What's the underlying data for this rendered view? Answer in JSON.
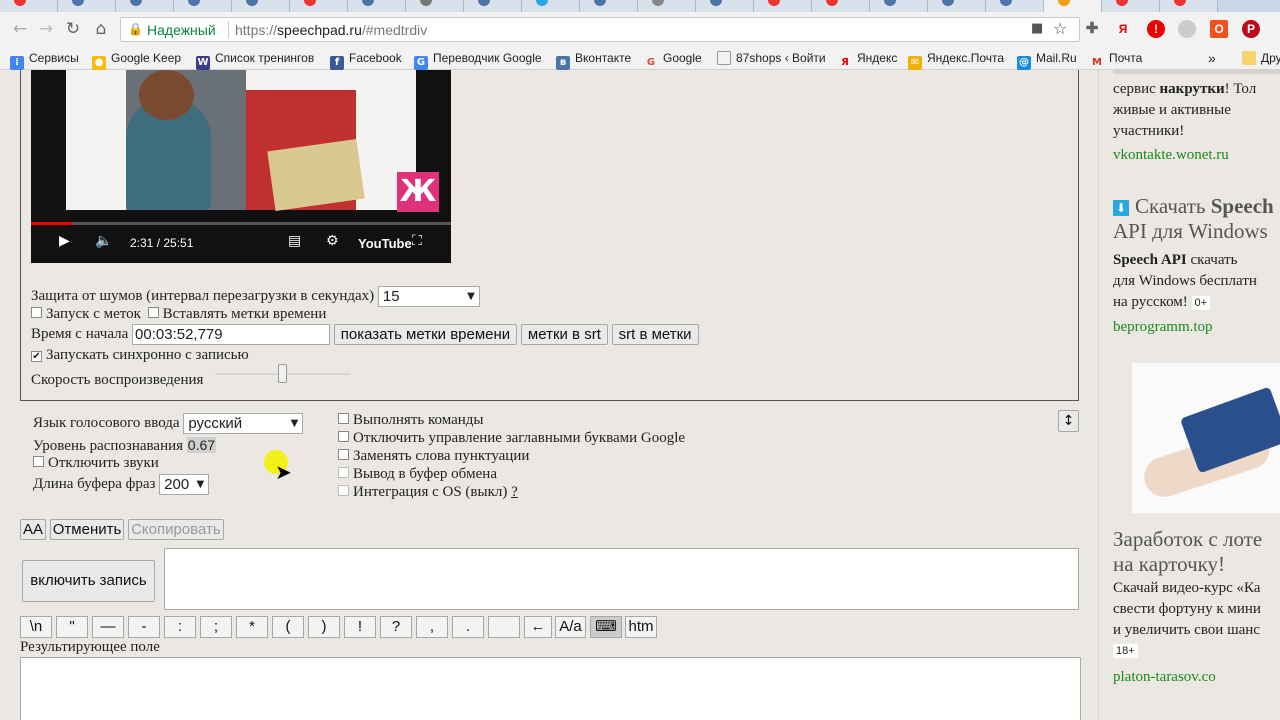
{
  "browser": {
    "security_label": "Надежный",
    "url_prefix": "https://",
    "url_host": "speechpad.ru",
    "url_path": "/#medtrdiv",
    "bookmarks": [
      {
        "label": "Сервисы",
        "icon": "apps-grid-icon",
        "color": "#4285f4"
      },
      {
        "label": "Google Keep",
        "icon": "keep-icon",
        "color": "#fbbc04"
      },
      {
        "label": "Список тренингов",
        "icon": "w-icon",
        "color": "#3a3a8a"
      },
      {
        "label": "Facebook",
        "icon": "facebook-icon",
        "color": "#3b5998"
      },
      {
        "label": "Переводчик Google",
        "icon": "translate-icon",
        "color": "#4285f4"
      },
      {
        "label": "Вконтакте",
        "icon": "vk-icon",
        "color": "#4a76a8"
      },
      {
        "label": "Google",
        "icon": "google-icon",
        "color": "#ea4335"
      },
      {
        "label": "87shops ‹ Войти",
        "icon": "page-icon",
        "color": "#777777"
      },
      {
        "label": "Яндекс",
        "icon": "yandex-icon",
        "color": "#e00000"
      },
      {
        "label": "Яндекс.Почта",
        "icon": "mail-envelope-icon",
        "color": "#f2b100"
      },
      {
        "label": "Mail.Ru",
        "icon": "at-icon",
        "color": "#168de2"
      },
      {
        "label": "Почта",
        "icon": "gmail-icon",
        "color": "#d93025"
      }
    ],
    "bookmarks_overflow": "»",
    "bookmarks_folder": "Дру"
  },
  "video": {
    "time": "2:31 / 25:51",
    "brand": "YouTube",
    "channel_logo": "Ж",
    "progress": 0.098
  },
  "settings": {
    "noise_label": "Защита от шумов (интервал перезагрузки в секундах)",
    "noise_value": "15",
    "start_from_marks": "Запуск с меток",
    "insert_time_marks": "Вставлять метки времени",
    "time_from_start_label": "Время с начала",
    "time_from_start_value": "00:03:52,779",
    "show_marks_button": "показать метки времени",
    "marks_to_srt_button": "метки в srt",
    "srt_to_marks_button": "srt в метки",
    "sync_label": "Запускать синхронно с записью",
    "sync_checked": true,
    "speed_label": "Скорость воспроизведения"
  },
  "voice": {
    "language_label": "Язык голосового ввода",
    "language_value": "русский",
    "recognition_label": "Уровень распознавания",
    "recognition_value": "0.67",
    "disable_sounds": "Отключить звуки",
    "buffer_label": "Длина буфера фраз",
    "buffer_value": "200",
    "options": [
      "Выполнять команды",
      "Отключить управление заглавными буквами Google",
      "Заменять слова пунктуации",
      "Вывод в буфер обмена",
      "Интеграция с OS (выкл)"
    ],
    "help_link": "?",
    "expand_icon": "↕"
  },
  "actions": {
    "aa_button": "AA",
    "undo_button": "Отменить",
    "copy_button": "Скопировать",
    "record_button": "включить запись"
  },
  "char_buttons": [
    "\\n",
    "\"",
    "—",
    "-",
    ":",
    ";",
    "*",
    "(",
    ")",
    "!",
    "?",
    ",",
    ".",
    "",
    "←",
    "A/a",
    "",
    "htm"
  ],
  "result_label": "Результирующее поле",
  "sidebar": {
    "ad1_text_1": "сервис ",
    "ad1_text_bold": "накрутки",
    "ad1_text_2": "! Тол",
    "ad1_text_3": "живые и активные",
    "ad1_text_4": "участники!",
    "ad1_link": "vkontakte.wonet.ru",
    "ad2_title_1": "Скачать ",
    "ad2_title_bold": "Speech",
    "ad2_title_2": "API для Windows",
    "ad2_text_bold": "Speech API",
    "ad2_text_1": " скачать",
    "ad2_text_2": "для Windows бесплатн",
    "ad2_text_3": "на русском!",
    "ad2_badge": "0+",
    "ad2_link": "beprogramm.top",
    "ad3_title_1": "Заработок с лоте",
    "ad3_title_2": "на карточку!",
    "ad3_text_1": "Скачай видео-курс «Ка",
    "ad3_text_2": "свести фортуну к мини",
    "ad3_text_3": "и увеличить свои шанс",
    "ad3_badge": "18+",
    "ad3_link": "platon-tarasov.co"
  }
}
